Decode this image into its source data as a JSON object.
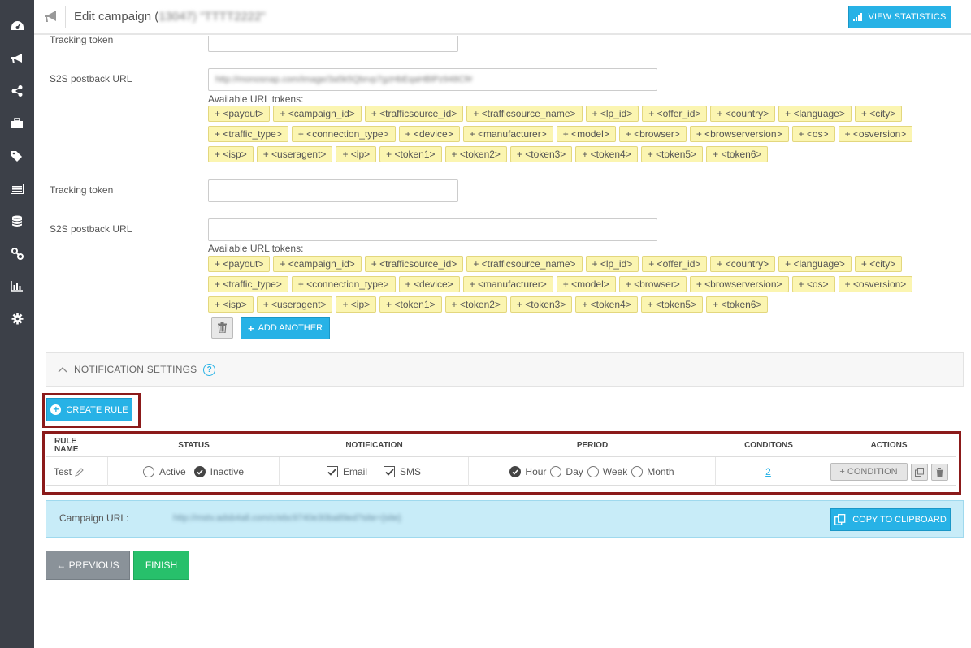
{
  "header": {
    "title_prefix": "Edit campaign (",
    "title_blurred": "13047) \"TTTT2222\"",
    "view_stats_label": "VIEW STATISTICS"
  },
  "sidebar": {
    "icons": [
      "dashboard-icon",
      "megaphone-icon",
      "share-icon",
      "briefcase-icon",
      "tags-icon",
      "list-icon",
      "database-icon",
      "link-icon",
      "bar-chart-icon",
      "gear-icon"
    ]
  },
  "postback1": {
    "tracking_label": "Tracking token",
    "s2s_label": "S2S postback URL",
    "s2s_value": "http://monosnap.com/image/3a5k5Qbrvp7gzHbEqaHBlPz948Cf#",
    "tokens_label": "Available URL tokens:"
  },
  "postback2": {
    "tracking_label": "Tracking token",
    "s2s_label": "S2S postback URL",
    "tokens_label": "Available URL tokens:"
  },
  "tokens": {
    "row1": [
      "+ <payout>",
      "+ <campaign_id>",
      "+ <trafficsource_id>",
      "+ <trafficsource_name>",
      "+ <lp_id>",
      "+ <offer_id>",
      "+ <country>",
      "+ <language>",
      "+ <city>"
    ],
    "row2": [
      "+ <traffic_type>",
      "+ <connection_type>",
      "+ <device>",
      "+ <manufacturer>",
      "+ <model>",
      "+ <browser>",
      "+ <browserversion>",
      "+ <os>",
      "+ <osversion>"
    ],
    "row3": [
      "+ <isp>",
      "+ <useragent>",
      "+ <ip>",
      "+ <token1>",
      "+ <token2>",
      "+ <token3>",
      "+ <token4>",
      "+ <token5>",
      "+ <token6>"
    ]
  },
  "add_another_label": "ADD ANOTHER",
  "notification_settings_label": "NOTIFICATION SETTINGS",
  "create_rule_label": "CREATE RULE",
  "rules_table": {
    "headers": {
      "rule_name": "RULE NAME",
      "status": "STATUS",
      "notification": "NOTIFICATION",
      "period": "PERIOD",
      "conditions": "CONDITONS",
      "actions": "ACTIONS"
    },
    "row": {
      "name": "Test",
      "status_active": "Active",
      "status_inactive": "Inactive",
      "email": "Email",
      "sms": "SMS",
      "hour": "Hour",
      "day": "Day",
      "week": "Week",
      "month": "Month",
      "conditions_count": "2",
      "condition_button": "+ CONDITION"
    }
  },
  "campaign_url": {
    "label": "Campaign URL:",
    "value": "http://mstv.adsb4all.com/c/ebc9740e30ba89ed?site={site}",
    "copy_label": "COPY TO CLIPBOARD"
  },
  "nav": {
    "previous_label": "← PREVIOUS",
    "finish_label": "FINISH"
  }
}
